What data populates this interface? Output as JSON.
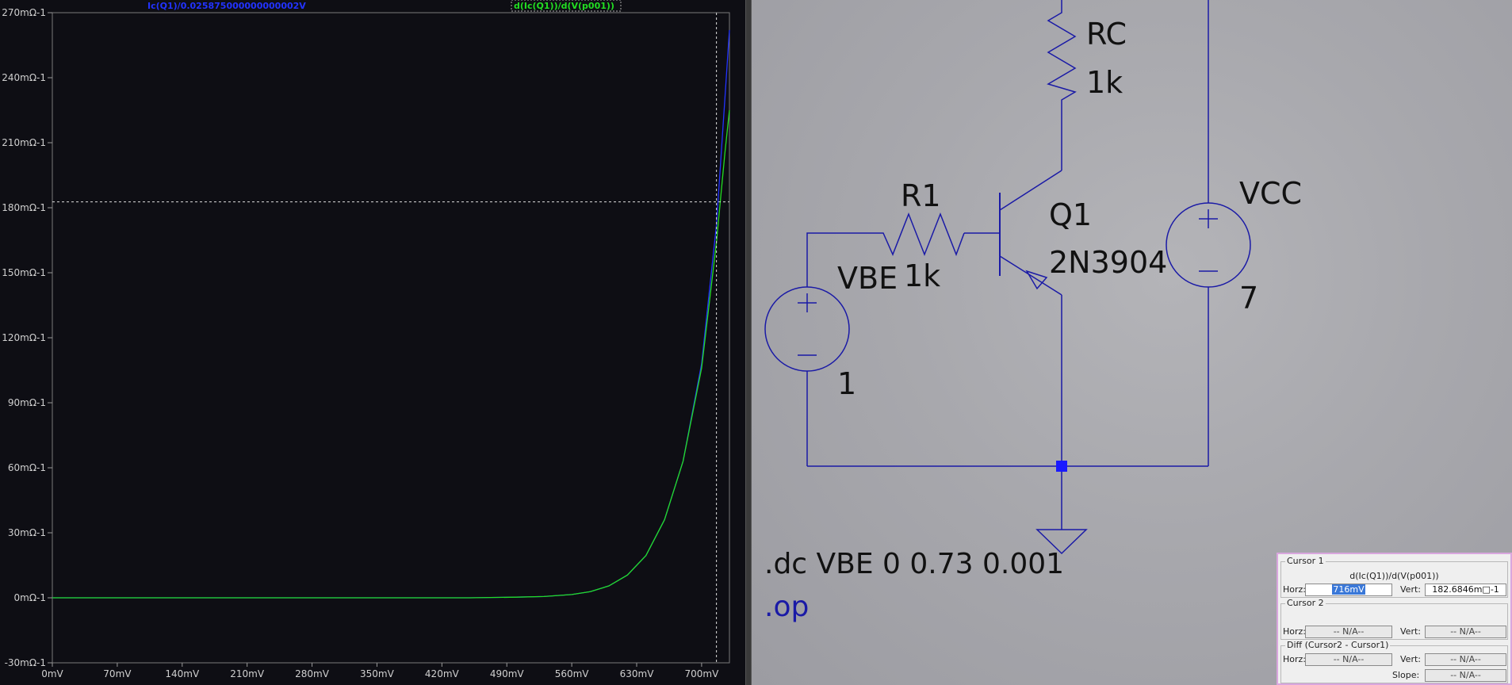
{
  "plot": {
    "trace_labels": [
      {
        "text": "Ic(Q1)/0.025875000000000002V",
        "color": "#2233ff"
      },
      {
        "text": "d(Ic(Q1))/d(V(p001))",
        "color": "#22dd22"
      }
    ],
    "y_ticks": [
      "270mΩ-1",
      "240mΩ-1",
      "210mΩ-1",
      "180mΩ-1",
      "150mΩ-1",
      "120mΩ-1",
      "90mΩ-1",
      "60mΩ-1",
      "30mΩ-1",
      "0mΩ-1",
      "-30mΩ-1"
    ],
    "x_ticks": [
      "0mV",
      "70mV",
      "140mV",
      "210mV",
      "280mV",
      "350mV",
      "420mV",
      "490mV",
      "560mV",
      "630mV",
      "700mV"
    ],
    "cursor": {
      "x_mv": 716,
      "y_m": 182.6846
    }
  },
  "chart_data": {
    "type": "line",
    "xlabel": "",
    "ylabel": "",
    "xlim": [
      0,
      730
    ],
    "ylim": [
      -30,
      270
    ],
    "x_unit": "mV",
    "y_unit": "mΩ-1",
    "grid": false,
    "series": [
      {
        "name": "Ic(Q1)/0.025875000000000002V",
        "color": "#2233ff",
        "x": [
          0,
          100,
          200,
          300,
          400,
          450,
          500,
          530,
          560,
          580,
          600,
          620,
          640,
          660,
          680,
          700,
          716,
          725,
          730
        ],
        "y": [
          0,
          0,
          0,
          0,
          0,
          0,
          0.3,
          0.6,
          1.5,
          2.8,
          5.5,
          10.5,
          19.5,
          36,
          63,
          108,
          172,
          230,
          262
        ]
      },
      {
        "name": "d(Ic(Q1))/d(V(p001))",
        "color": "#22dd22",
        "x": [
          0,
          100,
          200,
          300,
          400,
          450,
          500,
          530,
          560,
          580,
          600,
          620,
          640,
          660,
          680,
          700,
          716,
          725,
          730
        ],
        "y": [
          0,
          0,
          0,
          0,
          0,
          0,
          0.3,
          0.6,
          1.5,
          2.8,
          5.5,
          10.5,
          19.5,
          36,
          63,
          106,
          164,
          205,
          225
        ]
      }
    ]
  },
  "schematic": {
    "components": {
      "rc_name": "RC",
      "rc_value": "1k",
      "r1_name": "R1",
      "r1_value": "1k",
      "q1_name": "Q1",
      "q1_model": "2N3904",
      "vbe_name": "VBE",
      "vbe_value": "1",
      "vcc_name": "VCC",
      "vcc_value": "7"
    },
    "directives": {
      "dc": ".dc VBE 0 0.73 0.001",
      "op": ".op"
    },
    "wire_color": "#1a1aa6"
  },
  "cursor_panel": {
    "cursor1_title": "Cursor 1",
    "trace": "d(Ic(Q1))/d(V(p001))",
    "horz_label": "Horz:",
    "vert_label": "Vert:",
    "c1_horz": "716mV",
    "c1_vert": "182.6846m□-1",
    "cursor2_title": "Cursor 2",
    "c2_horz": "-- N/A--",
    "c2_vert": "-- N/A--",
    "diff_title": "Diff (Cursor2 - Cursor1)",
    "diff_horz": "-- N/A--",
    "diff_vert": "-- N/A--",
    "slope_label": "Slope:",
    "slope": "-- N/A--"
  }
}
